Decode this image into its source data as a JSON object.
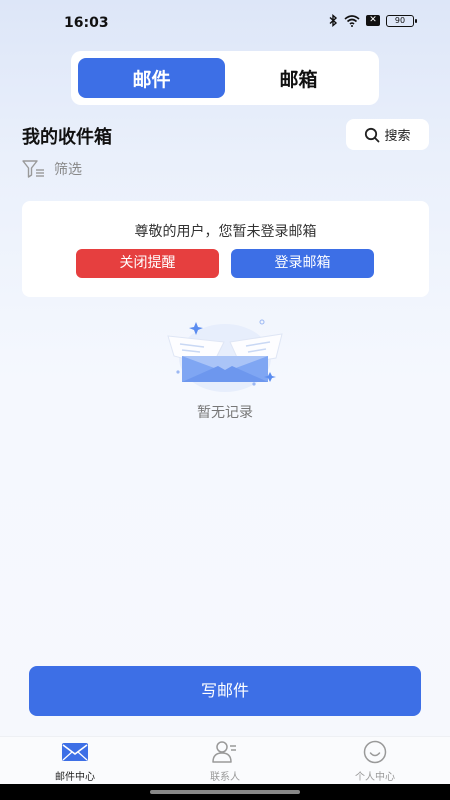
{
  "status": {
    "time": "16:03",
    "sim_label": "✕",
    "battery": "90"
  },
  "segment": {
    "tabs": [
      {
        "label": "邮件"
      },
      {
        "label": "邮箱"
      }
    ]
  },
  "inbox": {
    "title": "我的收件箱",
    "search_label": "搜索",
    "filter_label": "筛选"
  },
  "notice": {
    "message": "尊敬的用户，您暂未登录邮箱",
    "close_reminder_label": "关闭提醒",
    "login_label": "登录邮箱"
  },
  "empty": {
    "text": "暂无记录"
  },
  "compose": {
    "label": "写邮件"
  },
  "tabbar": {
    "items": [
      {
        "label": "邮件中心",
        "icon": "mail-icon"
      },
      {
        "label": "联系人",
        "icon": "contacts-icon"
      },
      {
        "label": "个人中心",
        "icon": "profile-icon"
      }
    ]
  },
  "colors": {
    "accent": "#3d6fe6",
    "danger": "#e63f3f",
    "background": "#eef2fb"
  }
}
